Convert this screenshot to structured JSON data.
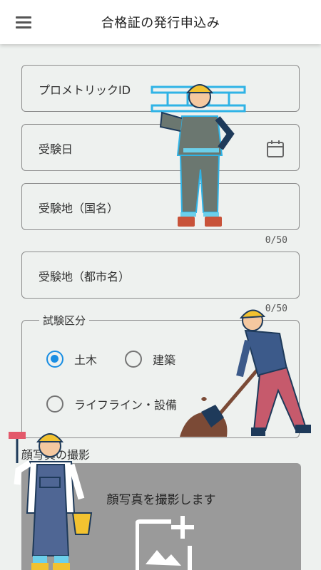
{
  "header": {
    "title": "合格証の発行申込み",
    "menu_icon": "hamburger-menu-icon"
  },
  "form": {
    "prometric_id": {
      "label": "プロメトリックID"
    },
    "exam_date": {
      "label": "受験日",
      "icon": "calendar-icon"
    },
    "exam_country": {
      "label": "受験地（国名）",
      "counter": "0/50"
    },
    "exam_city": {
      "label": "受験地（都市名）",
      "counter": "0/50"
    },
    "category": {
      "legend": "試験区分",
      "options": [
        {
          "label": "土木",
          "selected": true
        },
        {
          "label": "建築",
          "selected": false
        },
        {
          "label": "ライフライン・設備",
          "selected": false
        }
      ]
    }
  },
  "photo": {
    "section_title": "顔写真の撮影",
    "button_text": "顔写真を撮影します",
    "icon": "add-photo-icon"
  },
  "colors": {
    "accent": "#1a8ee3",
    "background": "#eef1ef",
    "photo_box": "#9a9a9a"
  }
}
